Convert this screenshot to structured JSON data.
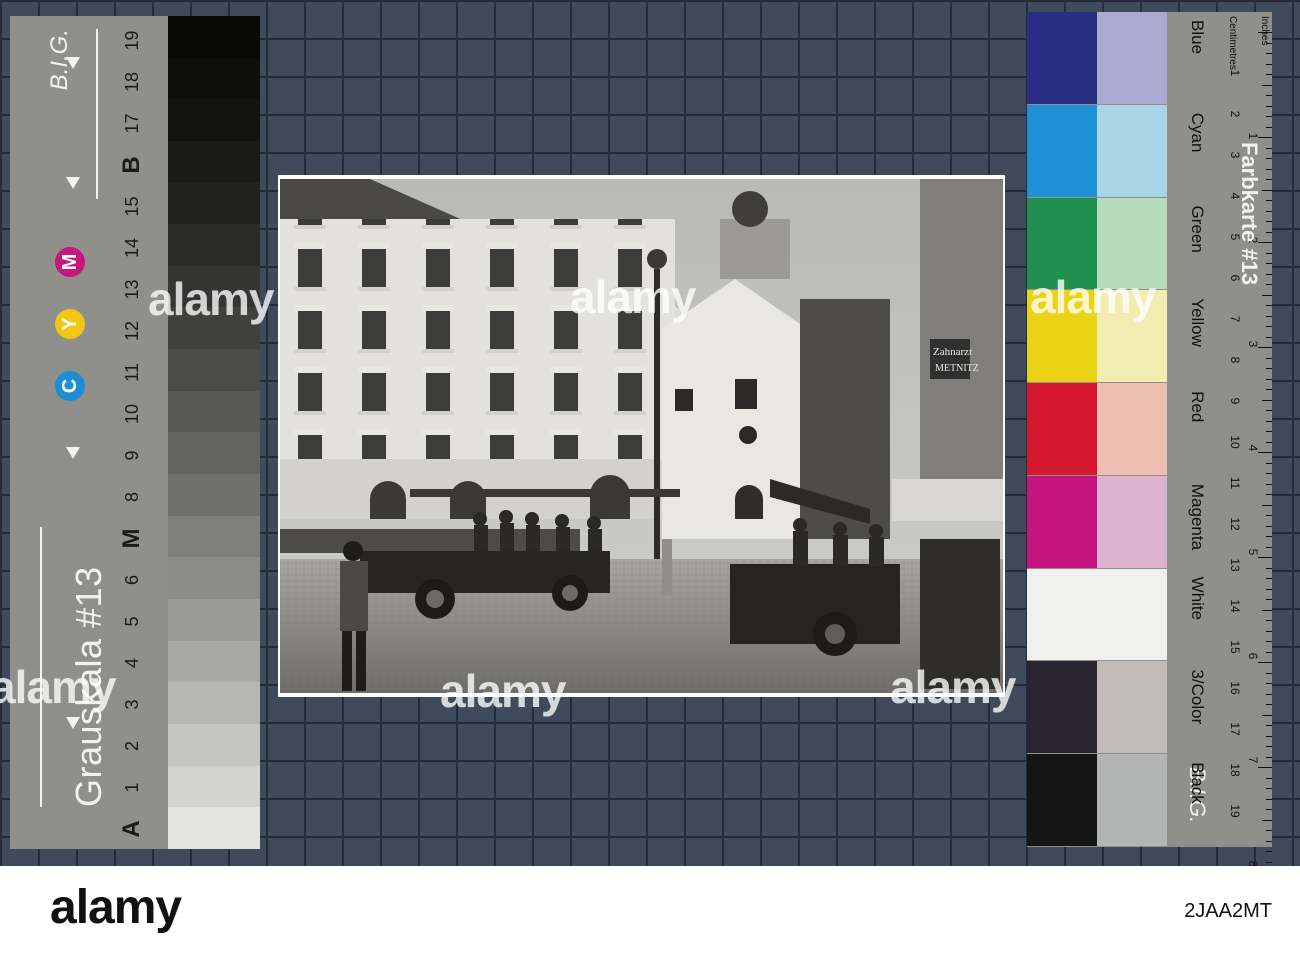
{
  "grey_card": {
    "title": "Grauskala #13",
    "brand": "B.I.G.",
    "cym_labels": [
      "C",
      "Y",
      "M"
    ],
    "cym_colors": [
      "#1d8ed4",
      "#f3c613",
      "#c8167f"
    ],
    "scale_numbers": [
      "A",
      "1",
      "2",
      "3",
      "4",
      "5",
      "6",
      "M",
      "8",
      "9",
      "10",
      "11",
      "12",
      "13",
      "14",
      "15",
      "B",
      "17",
      "18",
      "19"
    ],
    "steps": [
      "#e3e3e1",
      "#d3d3d1",
      "#c5c5c3",
      "#b6b6b4",
      "#a8a8a6",
      "#9a9a98",
      "#8c8c8a",
      "#7e7e7c",
      "#70706e",
      "#636361",
      "#575755",
      "#4b4b49",
      "#40403e",
      "#353533",
      "#2b2b29",
      "#222220",
      "#1a1a18",
      "#131311",
      "#0e0e0c",
      "#0a0a08"
    ]
  },
  "color_card": {
    "title": "Farbkarte #13",
    "brand": "B.I.G.",
    "ruler_inches_label": "Inches",
    "ruler_cm_label": "Centimetres",
    "ruler_inches": [
      "1",
      "2",
      "3",
      "4",
      "5",
      "6",
      "7",
      "8"
    ],
    "ruler_cm": [
      "1",
      "2",
      "3",
      "4",
      "5",
      "6",
      "7",
      "8",
      "9",
      "10",
      "11",
      "12",
      "13",
      "14",
      "15",
      "16",
      "17",
      "18",
      "19"
    ],
    "patches": [
      {
        "name": "Blue",
        "dark": "#2a2e83",
        "light": "#acaad0"
      },
      {
        "name": "Cyan",
        "dark": "#1f8fd6",
        "light": "#a9d4e8"
      },
      {
        "name": "Green",
        "dark": "#1f9050",
        "light": "#b6dcbc"
      },
      {
        "name": "Yellow",
        "dark": "#ead314",
        "light": "#f1ecb0"
      },
      {
        "name": "Red",
        "dark": "#d3182f",
        "light": "#eebfb0"
      },
      {
        "name": "Magenta",
        "dark": "#c5157e",
        "light": "#dcb3cf"
      },
      {
        "name": "White",
        "dark": "#f0f0ef",
        "light": "#f0f0ef"
      },
      {
        "name": "3/Color",
        "dark": "#2a2631",
        "light": "#c1bcb6"
      },
      {
        "name": "Black",
        "dark": "#151515",
        "light": "#b3b5b5"
      }
    ]
  },
  "photo": {
    "signs": [
      "Zahnarzt",
      "METNITZ"
    ]
  },
  "watermark": "alamy",
  "stock_bar": {
    "logo": "alamy",
    "image_id": "2JAA2MT"
  }
}
